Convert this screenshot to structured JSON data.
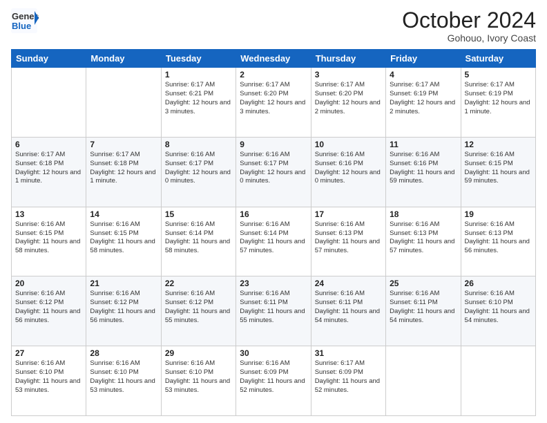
{
  "header": {
    "logo_general": "General",
    "logo_blue": "Blue",
    "month": "October 2024",
    "location": "Gohouo, Ivory Coast"
  },
  "weekdays": [
    "Sunday",
    "Monday",
    "Tuesday",
    "Wednesday",
    "Thursday",
    "Friday",
    "Saturday"
  ],
  "weeks": [
    [
      {
        "day": "",
        "info": ""
      },
      {
        "day": "",
        "info": ""
      },
      {
        "day": "1",
        "info": "Sunrise: 6:17 AM\nSunset: 6:21 PM\nDaylight: 12 hours and 3 minutes."
      },
      {
        "day": "2",
        "info": "Sunrise: 6:17 AM\nSunset: 6:20 PM\nDaylight: 12 hours and 3 minutes."
      },
      {
        "day": "3",
        "info": "Sunrise: 6:17 AM\nSunset: 6:20 PM\nDaylight: 12 hours and 2 minutes."
      },
      {
        "day": "4",
        "info": "Sunrise: 6:17 AM\nSunset: 6:19 PM\nDaylight: 12 hours and 2 minutes."
      },
      {
        "day": "5",
        "info": "Sunrise: 6:17 AM\nSunset: 6:19 PM\nDaylight: 12 hours and 1 minute."
      }
    ],
    [
      {
        "day": "6",
        "info": "Sunrise: 6:17 AM\nSunset: 6:18 PM\nDaylight: 12 hours and 1 minute."
      },
      {
        "day": "7",
        "info": "Sunrise: 6:17 AM\nSunset: 6:18 PM\nDaylight: 12 hours and 1 minute."
      },
      {
        "day": "8",
        "info": "Sunrise: 6:16 AM\nSunset: 6:17 PM\nDaylight: 12 hours and 0 minutes."
      },
      {
        "day": "9",
        "info": "Sunrise: 6:16 AM\nSunset: 6:17 PM\nDaylight: 12 hours and 0 minutes."
      },
      {
        "day": "10",
        "info": "Sunrise: 6:16 AM\nSunset: 6:16 PM\nDaylight: 12 hours and 0 minutes."
      },
      {
        "day": "11",
        "info": "Sunrise: 6:16 AM\nSunset: 6:16 PM\nDaylight: 11 hours and 59 minutes."
      },
      {
        "day": "12",
        "info": "Sunrise: 6:16 AM\nSunset: 6:15 PM\nDaylight: 11 hours and 59 minutes."
      }
    ],
    [
      {
        "day": "13",
        "info": "Sunrise: 6:16 AM\nSunset: 6:15 PM\nDaylight: 11 hours and 58 minutes."
      },
      {
        "day": "14",
        "info": "Sunrise: 6:16 AM\nSunset: 6:15 PM\nDaylight: 11 hours and 58 minutes."
      },
      {
        "day": "15",
        "info": "Sunrise: 6:16 AM\nSunset: 6:14 PM\nDaylight: 11 hours and 58 minutes."
      },
      {
        "day": "16",
        "info": "Sunrise: 6:16 AM\nSunset: 6:14 PM\nDaylight: 11 hours and 57 minutes."
      },
      {
        "day": "17",
        "info": "Sunrise: 6:16 AM\nSunset: 6:13 PM\nDaylight: 11 hours and 57 minutes."
      },
      {
        "day": "18",
        "info": "Sunrise: 6:16 AM\nSunset: 6:13 PM\nDaylight: 11 hours and 57 minutes."
      },
      {
        "day": "19",
        "info": "Sunrise: 6:16 AM\nSunset: 6:13 PM\nDaylight: 11 hours and 56 minutes."
      }
    ],
    [
      {
        "day": "20",
        "info": "Sunrise: 6:16 AM\nSunset: 6:12 PM\nDaylight: 11 hours and 56 minutes."
      },
      {
        "day": "21",
        "info": "Sunrise: 6:16 AM\nSunset: 6:12 PM\nDaylight: 11 hours and 56 minutes."
      },
      {
        "day": "22",
        "info": "Sunrise: 6:16 AM\nSunset: 6:12 PM\nDaylight: 11 hours and 55 minutes."
      },
      {
        "day": "23",
        "info": "Sunrise: 6:16 AM\nSunset: 6:11 PM\nDaylight: 11 hours and 55 minutes."
      },
      {
        "day": "24",
        "info": "Sunrise: 6:16 AM\nSunset: 6:11 PM\nDaylight: 11 hours and 54 minutes."
      },
      {
        "day": "25",
        "info": "Sunrise: 6:16 AM\nSunset: 6:11 PM\nDaylight: 11 hours and 54 minutes."
      },
      {
        "day": "26",
        "info": "Sunrise: 6:16 AM\nSunset: 6:10 PM\nDaylight: 11 hours and 54 minutes."
      }
    ],
    [
      {
        "day": "27",
        "info": "Sunrise: 6:16 AM\nSunset: 6:10 PM\nDaylight: 11 hours and 53 minutes."
      },
      {
        "day": "28",
        "info": "Sunrise: 6:16 AM\nSunset: 6:10 PM\nDaylight: 11 hours and 53 minutes."
      },
      {
        "day": "29",
        "info": "Sunrise: 6:16 AM\nSunset: 6:10 PM\nDaylight: 11 hours and 53 minutes."
      },
      {
        "day": "30",
        "info": "Sunrise: 6:16 AM\nSunset: 6:09 PM\nDaylight: 11 hours and 52 minutes."
      },
      {
        "day": "31",
        "info": "Sunrise: 6:17 AM\nSunset: 6:09 PM\nDaylight: 11 hours and 52 minutes."
      },
      {
        "day": "",
        "info": ""
      },
      {
        "day": "",
        "info": ""
      }
    ]
  ]
}
